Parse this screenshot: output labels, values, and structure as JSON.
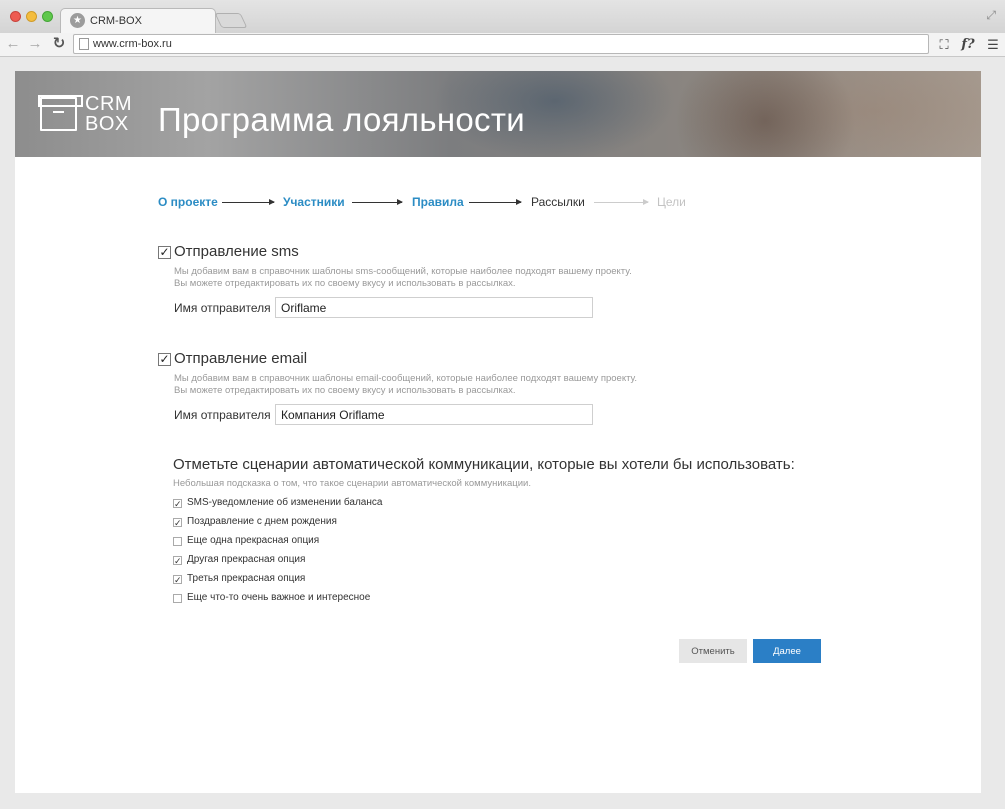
{
  "browser": {
    "tab_title": "CRM-BOX",
    "url": "www.crm-box.ru"
  },
  "header": {
    "logo_line1": "CRM",
    "logo_line2": "BOX",
    "title": "Программа лояльности"
  },
  "steps": [
    {
      "label": "О проекте",
      "state": "done"
    },
    {
      "label": "Участники",
      "state": "done"
    },
    {
      "label": "Правила",
      "state": "done"
    },
    {
      "label": "Рассылки",
      "state": "current"
    },
    {
      "label": "Цели",
      "state": "todo"
    }
  ],
  "sms": {
    "checked": true,
    "title": "Отправление sms",
    "hint_line1": "Мы добавим вам в справочник шаблоны sms-сообщений, которые наиболее подходят вашему проекту.",
    "hint_line2": "Вы можете отредактировать их по своему вкусу и использовать в рассылках.",
    "sender_label": "Имя отправителя",
    "sender_value": "Oriflame"
  },
  "email": {
    "checked": true,
    "title": "Отправление email",
    "hint_line1": "Мы добавим вам в справочник шаблоны email-сообщений, которые наиболее подходят вашему проекту.",
    "hint_line2": "Вы можете отредактировать их по своему вкусу и использовать в рассылках.",
    "sender_label": "Имя отправителя",
    "sender_value": "Компания Oriflame"
  },
  "scenarios": {
    "title": "Отметьте сценарии автоматической коммуникации, которые вы хотели бы использовать:",
    "hint": "Небольшая подсказка о том, что такое сценарии автоматической коммуникации.",
    "options": [
      {
        "label": "SMS-уведомление об изменении баланса",
        "checked": true
      },
      {
        "label": "Поздравление с днем рождения",
        "checked": true
      },
      {
        "label": "Еще одна прекрасная опция",
        "checked": false
      },
      {
        "label": "Другая прекрасная опция",
        "checked": true
      },
      {
        "label": "Третья прекрасная опция",
        "checked": true
      },
      {
        "label": "Еще что-то очень важное и интересное",
        "checked": false
      }
    ]
  },
  "buttons": {
    "cancel": "Отменить",
    "next": "Далее"
  },
  "colors": {
    "accent": "#2b8cc4",
    "primary_button": "#2b7fc6"
  }
}
